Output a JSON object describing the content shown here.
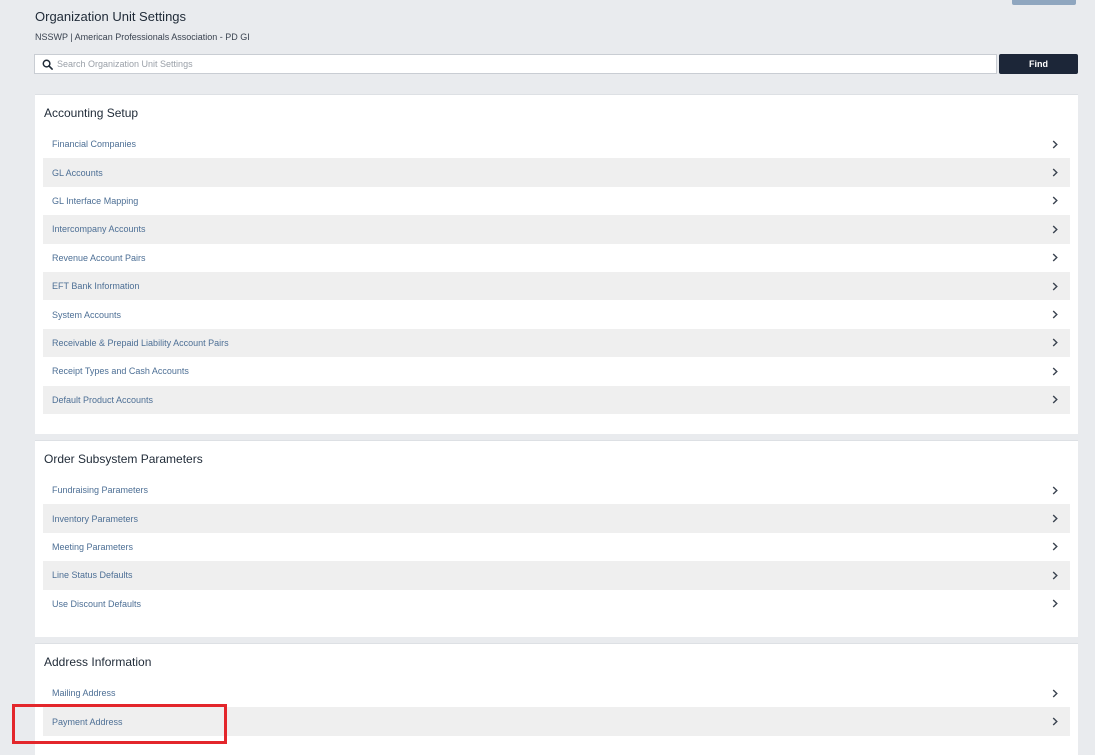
{
  "header": {
    "title": "Organization Unit Settings",
    "subtitle": "NSSWP | American Professionals Association - PD GI"
  },
  "search": {
    "placeholder": "Search Organization Unit Settings",
    "value": "",
    "find_label": "Find"
  },
  "sections": [
    {
      "title": "Accounting Setup",
      "items": [
        {
          "label": "Financial Companies"
        },
        {
          "label": "GL Accounts"
        },
        {
          "label": "GL Interface Mapping"
        },
        {
          "label": "Intercompany Accounts"
        },
        {
          "label": "Revenue Account Pairs"
        },
        {
          "label": "EFT Bank Information"
        },
        {
          "label": "System Accounts"
        },
        {
          "label": "Receivable & Prepaid Liability Account Pairs"
        },
        {
          "label": "Receipt Types and Cash Accounts"
        },
        {
          "label": "Default Product Accounts"
        }
      ]
    },
    {
      "title": "Order Subsystem Parameters",
      "items": [
        {
          "label": "Fundraising Parameters"
        },
        {
          "label": "Inventory Parameters"
        },
        {
          "label": "Meeting Parameters"
        },
        {
          "label": "Line Status Defaults"
        },
        {
          "label": "Use Discount Defaults"
        }
      ]
    },
    {
      "title": "Address Information",
      "items": [
        {
          "label": "Mailing Address"
        },
        {
          "label": "Payment Address"
        }
      ]
    }
  ],
  "icons": {
    "search": "search-icon",
    "row_chevron": "chevron-right-icon"
  },
  "colors": {
    "find_button": "#1c2638",
    "link_text": "#4d6f95",
    "alt_row": "#efefef",
    "highlight": "#e3262b",
    "page_background": "#e9ebee"
  }
}
